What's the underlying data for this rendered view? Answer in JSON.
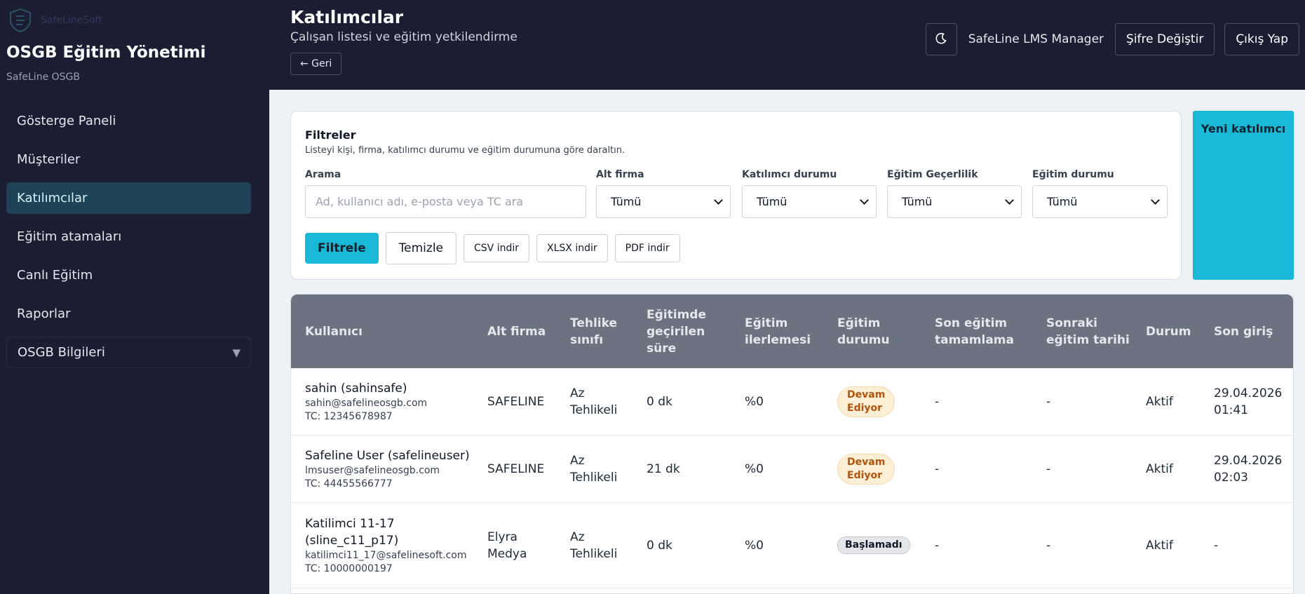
{
  "sidebar": {
    "logo_text": "SafeLineSoft",
    "title": "OSGB Eğitim Yönetimi",
    "subtitle": "SafeLine OSGB",
    "items": [
      {
        "label": "Gösterge Paneli"
      },
      {
        "label": "Müşteriler"
      },
      {
        "label": "Katılımcılar"
      },
      {
        "label": "Eğitim atamaları"
      },
      {
        "label": "Canlı Eğitim"
      },
      {
        "label": "Raporlar"
      },
      {
        "label": "OSGB Bilgileri"
      }
    ],
    "group_caret": "▼"
  },
  "header": {
    "title": "Katılımcılar",
    "subtitle": "Çalışan listesi ve eğitim yetkilendirme",
    "back_label": "← Geri",
    "user_name": "SafeLine LMS Manager",
    "change_password": "Şifre Değiştir",
    "logout": "Çıkış Yap",
    "theme_icon": "moon-icon"
  },
  "filters": {
    "title": "Filtreler",
    "subtitle": "Listeyi kişi, firma, katılımcı durumu ve eğitim durumuna göre daraltın.",
    "search_label": "Arama",
    "search_placeholder": "Ad, kullanıcı adı, e-posta veya TC ara",
    "subcompany_label": "Alt firma",
    "subcompany_value": "Tümü",
    "participant_status_label": "Katılımcı durumu",
    "participant_status_value": "Tümü",
    "validity_label": "Eğitim Geçerlilik",
    "validity_value": "Tümü",
    "training_status_label": "Eğitim durumu",
    "training_status_value": "Tümü",
    "filter_btn": "Filtrele",
    "clear_btn": "Temizle",
    "csv_btn": "CSV indir",
    "xlsx_btn": "XLSX indir",
    "pdf_btn": "PDF indir"
  },
  "new_participant": "Yeni katılımcı",
  "table": {
    "columns": [
      {
        "l1": "Kullanıcı",
        "l2": "",
        "l3": ""
      },
      {
        "l1": "Alt firma",
        "l2": "",
        "l3": ""
      },
      {
        "l1": "Tehlike",
        "l2": "sınıfı",
        "l3": ""
      },
      {
        "l1": "Eğitimde",
        "l2": "geçirilen",
        "l3": "süre"
      },
      {
        "l1": "Eğitim",
        "l2": "ilerlemesi",
        "l3": ""
      },
      {
        "l1": "Eğitim",
        "l2": "durumu",
        "l3": ""
      },
      {
        "l1": "Son eğitim",
        "l2": "tamamlama",
        "l3": ""
      },
      {
        "l1": "Sonraki",
        "l2": "eğitim tarihi",
        "l3": ""
      },
      {
        "l1": "Durum",
        "l2": "",
        "l3": ""
      },
      {
        "l1": "Son giriş",
        "l2": "",
        "l3": ""
      }
    ],
    "rows": [
      {
        "name1": "sahin (sahinsafe)",
        "name2": "",
        "email": "sahin@safelineosgb.com",
        "tc": "TC: 12345678987",
        "company1": "SAFELINE",
        "company2": "",
        "hazard1": "Az",
        "hazard2": "Tehlikeli",
        "time": "0 dk",
        "progress": "%0",
        "status1": "Devam",
        "status2": "Ediyor",
        "last_complete": "-",
        "next_date": "-",
        "state": "Aktif",
        "login1": "29.04.2026",
        "login2": "01:41"
      },
      {
        "name1": "Safeline User (safelineuser)",
        "name2": "",
        "email": "lmsuser@safelineosgb.com",
        "tc": "TC: 44455566777",
        "company1": "SAFELINE",
        "company2": "",
        "hazard1": "Az",
        "hazard2": "Tehlikeli",
        "time": "21 dk",
        "progress": "%0",
        "status1": "Devam",
        "status2": "Ediyor",
        "last_complete": "-",
        "next_date": "-",
        "state": "Aktif",
        "login1": "29.04.2026",
        "login2": "02:03"
      },
      {
        "name1": "Katilimci 11-17",
        "name2": "(sline_c11_p17)",
        "email": "katilimci11_17@safelinesoft.com",
        "tc": "TC: 10000000197",
        "company1": "Elyra",
        "company2": "Medya",
        "hazard1": "Az",
        "hazard2": "Tehlikeli",
        "time": "0 dk",
        "progress": "%0",
        "status1": "Başlamadı",
        "status2": "",
        "last_complete": "-",
        "next_date": "-",
        "state": "Aktif",
        "login1": "-",
        "login2": ""
      }
    ]
  },
  "colors": {
    "sidebar_bg": "#1b1e33",
    "accent": "#18b8d6",
    "active_nav": "#1d4455",
    "table_header": "#6b7280",
    "badge_warn_bg": "#fdefd6",
    "badge_warn_text": "#b45309"
  }
}
